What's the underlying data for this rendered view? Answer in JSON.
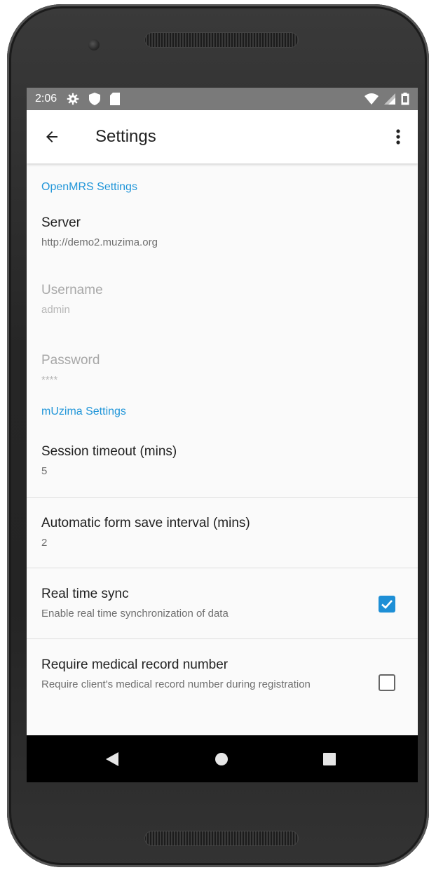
{
  "status_bar": {
    "time": "2:06",
    "left_icons": [
      "settings-icon",
      "shield-icon",
      "sd-card-icon"
    ],
    "right_icons": [
      "wifi-icon",
      "cell-signal-icon",
      "battery-icon"
    ]
  },
  "app_bar": {
    "title": "Settings",
    "back_icon": "arrow-left-icon",
    "menu_icon": "more-vert-icon"
  },
  "sections": {
    "openmrs": {
      "header": "OpenMRS Settings",
      "server": {
        "title": "Server",
        "summary": "http://demo2.muzima.org"
      },
      "username": {
        "title": "Username",
        "summary": "admin",
        "enabled": false
      },
      "password": {
        "title": "Password",
        "summary": "****",
        "enabled": false
      }
    },
    "muzima": {
      "header": "mUzima Settings",
      "session_timeout": {
        "title": "Session timeout (mins)",
        "summary": "5"
      },
      "autosave": {
        "title": "Automatic form save interval (mins)",
        "summary": "2"
      },
      "realtime_sync": {
        "title": "Real time sync",
        "summary": "Enable real time synchronization of data",
        "checked": true
      },
      "require_mrn": {
        "title": "Require medical record number",
        "summary": "Require client's medical record number during registration",
        "checked": false
      }
    }
  },
  "nav_bar": {
    "items": [
      "back-triangle-icon",
      "home-circle-icon",
      "recents-square-icon"
    ]
  },
  "colors": {
    "accent": "#2196d9",
    "status_bar": "#7a7a7a",
    "checkbox_checked": "#1e8fd6"
  }
}
